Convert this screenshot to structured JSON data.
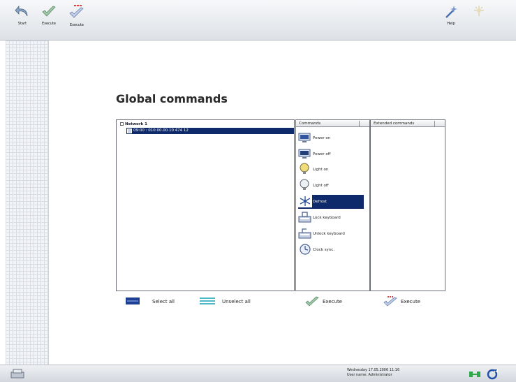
{
  "toolbar": {
    "buttons": [
      {
        "label": "Start",
        "icon": "back-arrow-icon"
      },
      {
        "label": "Execute",
        "icon": "checkmark-icon"
      },
      {
        "label": "Execute",
        "icon": "execute-all-icon"
      }
    ],
    "right_buttons": [
      {
        "label": "Help",
        "icon": "help-wand-icon"
      },
      {
        "label": "",
        "icon": "wizard-icon"
      }
    ]
  },
  "page": {
    "title": "Global commands"
  },
  "tree": {
    "network_label": "Network 1",
    "nodes": [
      {
        "label": "09:00 : 010.00.00.10 474 12"
      }
    ]
  },
  "commands_panel": {
    "header": "Commands",
    "items": [
      {
        "label": "Power on",
        "icon": "monitor-power-on-icon",
        "selected": false
      },
      {
        "label": "Power off",
        "icon": "monitor-power-off-icon",
        "selected": false
      },
      {
        "label": "Light on",
        "icon": "lightbulb-on-icon",
        "selected": false
      },
      {
        "label": "Light off",
        "icon": "lightbulb-off-icon",
        "selected": false
      },
      {
        "label": "Defrost",
        "icon": "snowflake-icon",
        "selected": true
      },
      {
        "label": "Lock keyboard",
        "icon": "keyboard-lock-icon",
        "selected": false
      },
      {
        "label": "Unlock keyboard",
        "icon": "keyboard-unlock-icon",
        "selected": false
      },
      {
        "label": "Clock sync.",
        "icon": "clock-icon",
        "selected": false
      }
    ]
  },
  "extended_panel": {
    "header": "Extended commands"
  },
  "actions": {
    "select_all": "Select all",
    "unselect_all": "Unselect all",
    "execute": "Execute",
    "execute_all": "Execute"
  },
  "status_bar": {
    "date_line": "Wednesday  17.05.2006     11:16",
    "user_line": "User name:  Administrator"
  },
  "colors": {
    "selection": "#0f2a6b",
    "accent_green": "#2ea84a",
    "accent_blue": "#1f4fa8"
  }
}
